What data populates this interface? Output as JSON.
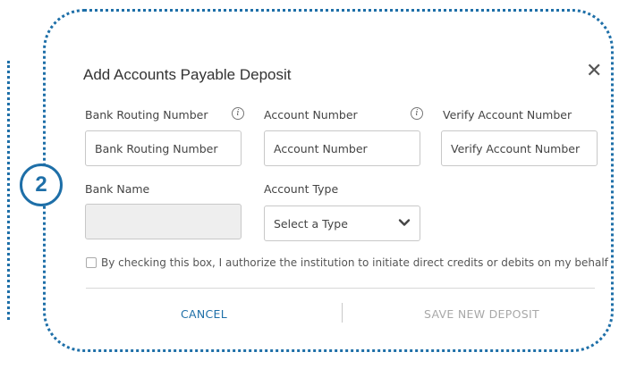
{
  "step_number": "2",
  "dialog": {
    "title": "Add Accounts Payable Deposit",
    "close_symbol": "✕"
  },
  "fields": {
    "routing": {
      "label": "Bank Routing Number",
      "placeholder": "Bank Routing Number",
      "info": "i"
    },
    "account": {
      "label": "Account Number",
      "placeholder": "Account Number",
      "info": "i"
    },
    "verify": {
      "label": "Verify Account Number",
      "placeholder": "Verify Account Number"
    },
    "bank_name": {
      "label": "Bank Name",
      "value": ""
    },
    "account_type": {
      "label": "Account Type",
      "selected": "Select a Type"
    }
  },
  "consent": {
    "text": "By checking this box, I authorize the institution to initiate direct credits or debits on my behalf",
    "checked": false
  },
  "footer": {
    "cancel_label": "CANCEL",
    "save_label": "SAVE NEW DEPOSIT"
  },
  "colors": {
    "accent": "#1e6fa8",
    "disabled_text": "#a8a8a8"
  }
}
